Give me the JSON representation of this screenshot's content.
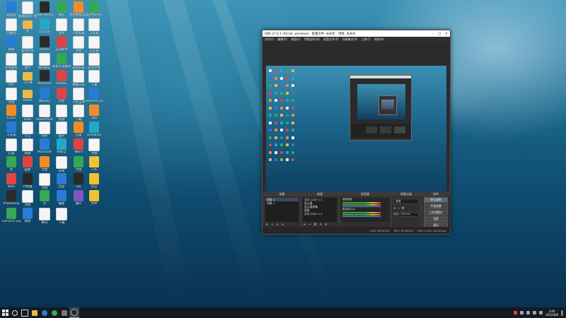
{
  "desktop": {
    "icons": [
      {
        "label": "此电脑",
        "kind": "blue"
      },
      {
        "label": "播放器客户端",
        "kind": "doc"
      },
      {
        "label": "OBS Studio",
        "kind": "dark"
      },
      {
        "label": "微信",
        "kind": "green"
      },
      {
        "label": "也想看看电影",
        "kind": "orange"
      },
      {
        "label": "证件照制作",
        "kind": "green"
      },
      {
        "label": "回收站",
        "kind": "doc"
      },
      {
        "label": "文",
        "kind": "folder"
      },
      {
        "label": "QQ音乐",
        "kind": "cyan"
      },
      {
        "label": "文件",
        "kind": "doc"
      },
      {
        "label": "千影剪辑",
        "kind": "doc"
      },
      {
        "label": "工作表",
        "kind": "doc"
      },
      {
        "label": "网络",
        "kind": "blue"
      },
      {
        "label": "新建文本",
        "kind": "doc"
      },
      {
        "label": "Steam",
        "kind": "dark"
      },
      {
        "label": "迅游助手",
        "kind": "red"
      },
      {
        "label": "文档",
        "kind": "doc"
      },
      {
        "label": "工作表",
        "kind": "doc"
      },
      {
        "label": "控制面板",
        "kind": "doc"
      },
      {
        "label": "图片",
        "kind": "doc"
      },
      {
        "label": "腾讯会议",
        "kind": "doc"
      },
      {
        "label": "网易有道翻译",
        "kind": "green"
      },
      {
        "label": "视频剪辑",
        "kind": "doc"
      },
      {
        "label": "新建文本",
        "kind": "doc"
      },
      {
        "label": "文件",
        "kind": "doc"
      },
      {
        "label": "工作簿",
        "kind": "folder"
      },
      {
        "label": "WeGame",
        "kind": "dark"
      },
      {
        "label": "ADOBE",
        "kind": "red"
      },
      {
        "label": "数据记录",
        "kind": "doc"
      },
      {
        "label": "下载",
        "kind": "doc"
      },
      {
        "label": "文档",
        "kind": "doc"
      },
      {
        "label": "Adobe",
        "kind": "folder"
      },
      {
        "label": "腾讯QQ",
        "kind": "blue"
      },
      {
        "label": "文档",
        "kind": "red"
      },
      {
        "label": "学生证件",
        "kind": "doc"
      },
      {
        "label": "Internet Explorer",
        "kind": "blue"
      },
      {
        "label": "Excel",
        "kind": "orange"
      },
      {
        "label": "Data",
        "kind": "doc"
      },
      {
        "label": "PowerPoint",
        "kind": "doc"
      },
      {
        "label": "视频",
        "kind": "doc"
      },
      {
        "label": "下载",
        "kind": "doc"
      },
      {
        "label": "360",
        "kind": "orange"
      },
      {
        "label": "工作表",
        "kind": "blue"
      },
      {
        "label": "学习",
        "kind": "doc"
      },
      {
        "label": "文件",
        "kind": "doc"
      },
      {
        "label": "图片",
        "kind": "doc"
      },
      {
        "label": "迅雷",
        "kind": "orange"
      },
      {
        "label": "OneDrive",
        "kind": "cyan"
      },
      {
        "label": "记录",
        "kind": "doc"
      },
      {
        "label": "视频",
        "kind": "doc"
      },
      {
        "label": "Microsoft",
        "kind": "blue"
      },
      {
        "label": "网易云",
        "kind": "cyan"
      },
      {
        "label": "Word",
        "kind": "red"
      },
      {
        "label": "文档",
        "kind": "doc"
      },
      {
        "label": "文",
        "kind": "green"
      },
      {
        "label": "画图",
        "kind": "red"
      },
      {
        "label": "文档",
        "kind": "orange"
      },
      {
        "label": "剪映",
        "kind": "doc"
      },
      {
        "label": "文档",
        "kind": "green"
      },
      {
        "label": "工作",
        "kind": "yellow"
      },
      {
        "label": "WPS",
        "kind": "red"
      },
      {
        "label": "计算器",
        "kind": "dark"
      },
      {
        "label": "文档",
        "kind": "doc"
      },
      {
        "label": "百度",
        "kind": "blue"
      },
      {
        "label": "QQ",
        "kind": "dark"
      },
      {
        "label": "音乐",
        "kind": "yellow"
      },
      {
        "label": "Photoshop",
        "kind": "dark"
      },
      {
        "label": "文档",
        "kind": "doc"
      },
      {
        "label": "文",
        "kind": "green"
      },
      {
        "label": "截图",
        "kind": "blue"
      },
      {
        "label": "图片",
        "kind": "purple"
      },
      {
        "label": "文件",
        "kind": "yellow"
      },
      {
        "label": "GeForce Experience",
        "kind": "green"
      },
      {
        "label": "网易",
        "kind": "blue"
      },
      {
        "label": "腾讯",
        "kind": "doc"
      },
      {
        "label": "下载",
        "kind": "doc"
      }
    ]
  },
  "obs": {
    "title": "OBS 27.0.1 (64-bit, windows) - 配置文件: 未命名 - 场景: 未命名",
    "menu": [
      "文件(F)",
      "编辑(E)",
      "视图(V)",
      "停靠部件(D)",
      "配置文件(P)",
      "场景集合(S)",
      "工具(T)",
      "帮助(H)"
    ],
    "docks": {
      "scenes": {
        "header": "场景",
        "items": [
          "场景 2",
          "场景 3"
        ]
      },
      "sources": {
        "header": "来源",
        "items": [
          "文本 (GDI+) 2",
          "显示器",
          "显示器采集",
          "视频",
          "文本 (GDI+) 3"
        ]
      },
      "mixer": {
        "header": "混音器",
        "channels": [
          "桌面音频",
          "麦克风/Aux"
        ],
        "levels": [
          "0.0 dB",
          "0.0 dB"
        ]
      },
      "transitions": {
        "header": "场景过渡",
        "type": "渐变",
        "duration_label": "时长",
        "duration": "300 ms"
      },
      "controls": {
        "header": "控件",
        "buttons": [
          "停止录制",
          "开始直播",
          "工作室模式",
          "设置",
          "退出"
        ]
      }
    },
    "status": [
      "LIVE: 00:00:00",
      "REC: 00:00:00",
      "CPU: 2.3%, 30.00 fps"
    ]
  },
  "taskbar": {
    "time": "3:40",
    "date": "2022/8/8"
  }
}
